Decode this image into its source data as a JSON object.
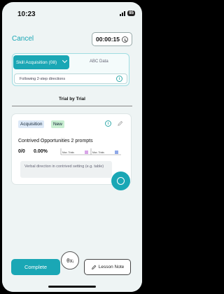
{
  "status_bar": {
    "time": "10:23",
    "battery": "85"
  },
  "header": {
    "cancel_label": "Cancel",
    "timer": "00:00:15"
  },
  "skill": {
    "selected": "Skill Acquisition (08)",
    "abc_tab": "ABC Data",
    "directions": "Following 2-step directions"
  },
  "view_tab": "Trial by Trial",
  "card": {
    "badges": [
      "Acquisition",
      "New"
    ],
    "target": "Contrived Opportunities 2 prompts",
    "count": "0/0",
    "percent": "0.00%",
    "legend": [
      "Max. Trials",
      "Max. Trials"
    ],
    "note": "Verbal direction in contrived setting (e.g. table)"
  },
  "footer": {
    "complete_label": "Complete",
    "center_label": "θxᵢ",
    "lesson_note_label": "Lesson Note"
  },
  "colors": {
    "accent": "#1aa7b5"
  }
}
